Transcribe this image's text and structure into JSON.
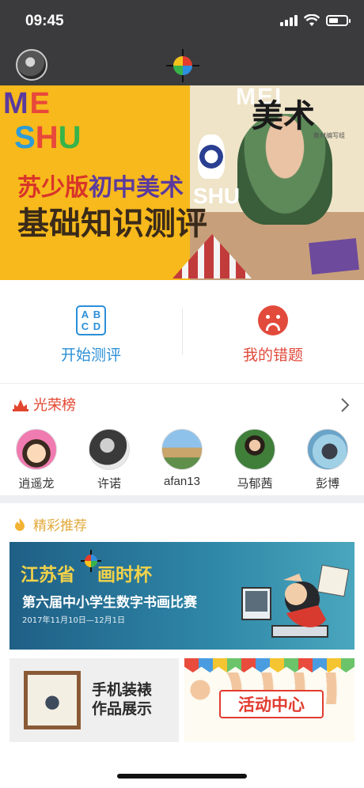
{
  "status_bar": {
    "time": "09:45",
    "battery_level": 0.55
  },
  "banner": {
    "latin_top": "ME",
    "latin_bottom": "SHU",
    "ghost_top": "MEI",
    "ghost_bottom": "SHU",
    "title_cn": "美术",
    "line1_a": "苏少版",
    "line1_b": "初中美术",
    "line2": "基础知识测评",
    "caption": "教材编写组",
    "colors": {
      "background": "#f7b91b",
      "red": "#d8342a",
      "purple": "#5b3a9e"
    }
  },
  "actions": [
    {
      "label": "开始测评",
      "icon": "abcd-icon",
      "icon_text": [
        "A",
        "B",
        "C",
        "D"
      ],
      "color": "#2a8fd8"
    },
    {
      "label": "我的错题",
      "icon": "sad-face-icon",
      "color": "#e24a3b"
    }
  ],
  "honor_roll": {
    "title": "光荣榜",
    "people": [
      {
        "name": "逍遥龙"
      },
      {
        "name": "许诺"
      },
      {
        "name": "afan13"
      },
      {
        "name": "马郁茜"
      },
      {
        "name": "彭博"
      }
    ]
  },
  "recommend": {
    "title": "精彩推荐",
    "main_banner": {
      "headline_a": "江苏省",
      "headline_b": "画时杯",
      "subtitle": "第六届中小学生数字书画比赛",
      "dates": "2017年11月10日—12月1日"
    },
    "cards": [
      {
        "line1": "手机装裱",
        "line2": "作品展示"
      },
      {
        "label": "活动中心"
      }
    ]
  }
}
